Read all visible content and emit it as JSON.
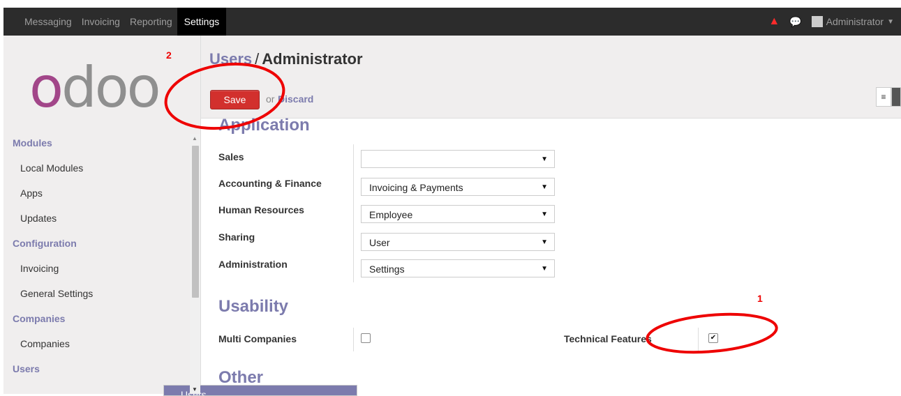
{
  "topbar": {
    "menu": [
      "Messaging",
      "Invoicing",
      "Reporting",
      "Settings"
    ],
    "active": "Settings",
    "user": "Administrator"
  },
  "sidebar": {
    "logo": "odoo",
    "sections": [
      {
        "title": "Modules",
        "items": [
          "Local Modules",
          "Apps",
          "Updates"
        ]
      },
      {
        "title": "Configuration",
        "items": [
          "Invoicing",
          "General Settings"
        ]
      },
      {
        "title": "Companies",
        "items": [
          "Companies"
        ]
      },
      {
        "title": "Users",
        "items": [
          "Users"
        ]
      }
    ]
  },
  "header": {
    "breadcrumb_link": "Users",
    "breadcrumb_sep": "/",
    "breadcrumb_current": "Administrator",
    "save_label": "Save",
    "or_label": "or",
    "discard_label": "Discard"
  },
  "form": {
    "application_title": "Application",
    "fields": [
      {
        "label": "Sales",
        "value": ""
      },
      {
        "label": "Accounting & Finance",
        "value": "Invoicing & Payments"
      },
      {
        "label": "Human Resources",
        "value": "Employee"
      },
      {
        "label": "Sharing",
        "value": "User"
      },
      {
        "label": "Administration",
        "value": "Settings"
      }
    ],
    "usability_title": "Usability",
    "multi_companies_label": "Multi Companies",
    "multi_companies_checked": false,
    "technical_features_label": "Technical Features",
    "technical_features_checked": true,
    "other_title": "Other"
  },
  "annotations": {
    "first": "1",
    "second": "2"
  },
  "colors": {
    "accent": "#7c7bad",
    "save": "#d2302d",
    "topbar": "#2c2c2c",
    "annotation": "#ee0000"
  }
}
